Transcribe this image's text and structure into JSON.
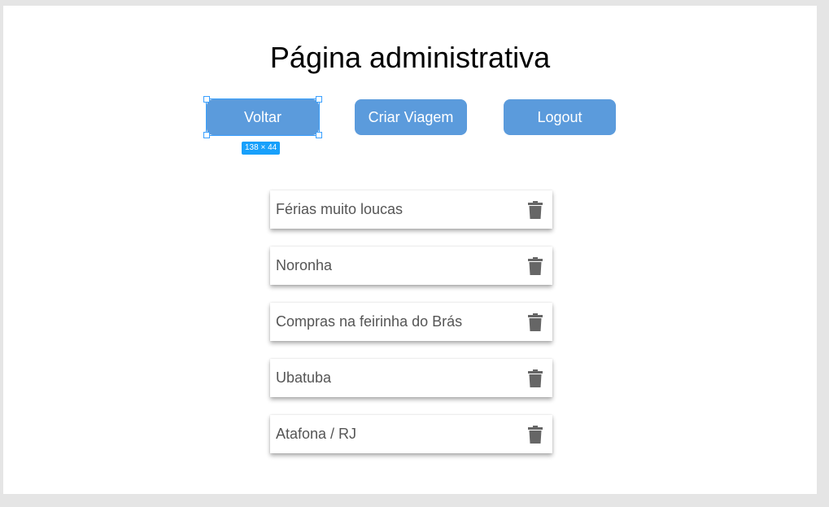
{
  "page": {
    "title": "Página administrativa"
  },
  "buttons": {
    "back_label": "Voltar",
    "create_trip_label": "Criar Viagem",
    "logout_label": "Logout"
  },
  "selection": {
    "size_badge": "138 × 44"
  },
  "trips": [
    {
      "name": "Férias muito loucas",
      "action_icon": "trash-icon"
    },
    {
      "name": "Noronha",
      "action_icon": "trash-icon"
    },
    {
      "name": "Compras na feirinha do Brás",
      "action_icon": "trash-icon"
    },
    {
      "name": "Ubatuba",
      "action_icon": "trash-icon"
    },
    {
      "name": "Atafona / RJ",
      "action_icon": "trash-icon"
    }
  ],
  "colors": {
    "accent": "#5b9bdc",
    "selection": "#18a0fb",
    "icon": "#666666"
  }
}
